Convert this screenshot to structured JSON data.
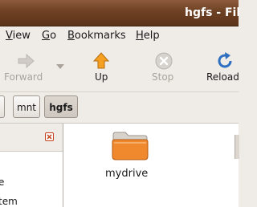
{
  "window": {
    "title": "hgfs - Fil"
  },
  "menu": [
    {
      "label": "View",
      "accel": "V",
      "rest": "iew"
    },
    {
      "label": "Go",
      "accel": "G",
      "rest": "o"
    },
    {
      "label": "Bookmarks",
      "accel": "B",
      "rest": "ookmarks"
    },
    {
      "label": "Help",
      "accel": "H",
      "rest": "elp"
    }
  ],
  "toolbar": {
    "forward_label": "Forward",
    "up_label": "Up",
    "stop_label": "Stop",
    "reload_label": "Reload"
  },
  "pathbar": {
    "items": [
      "mnt",
      "hgfs"
    ]
  },
  "sidepane": {
    "lines": [
      "e",
      "tem"
    ]
  },
  "content": {
    "items": [
      {
        "name": "mydrive",
        "icon": "folder-icon"
      }
    ]
  },
  "colors": {
    "titlebar": "#6e4124",
    "folder": "#f0882e",
    "up_arrow": "#f5a021",
    "reload": "#2e6fc1",
    "close_x": "#c4441c"
  }
}
